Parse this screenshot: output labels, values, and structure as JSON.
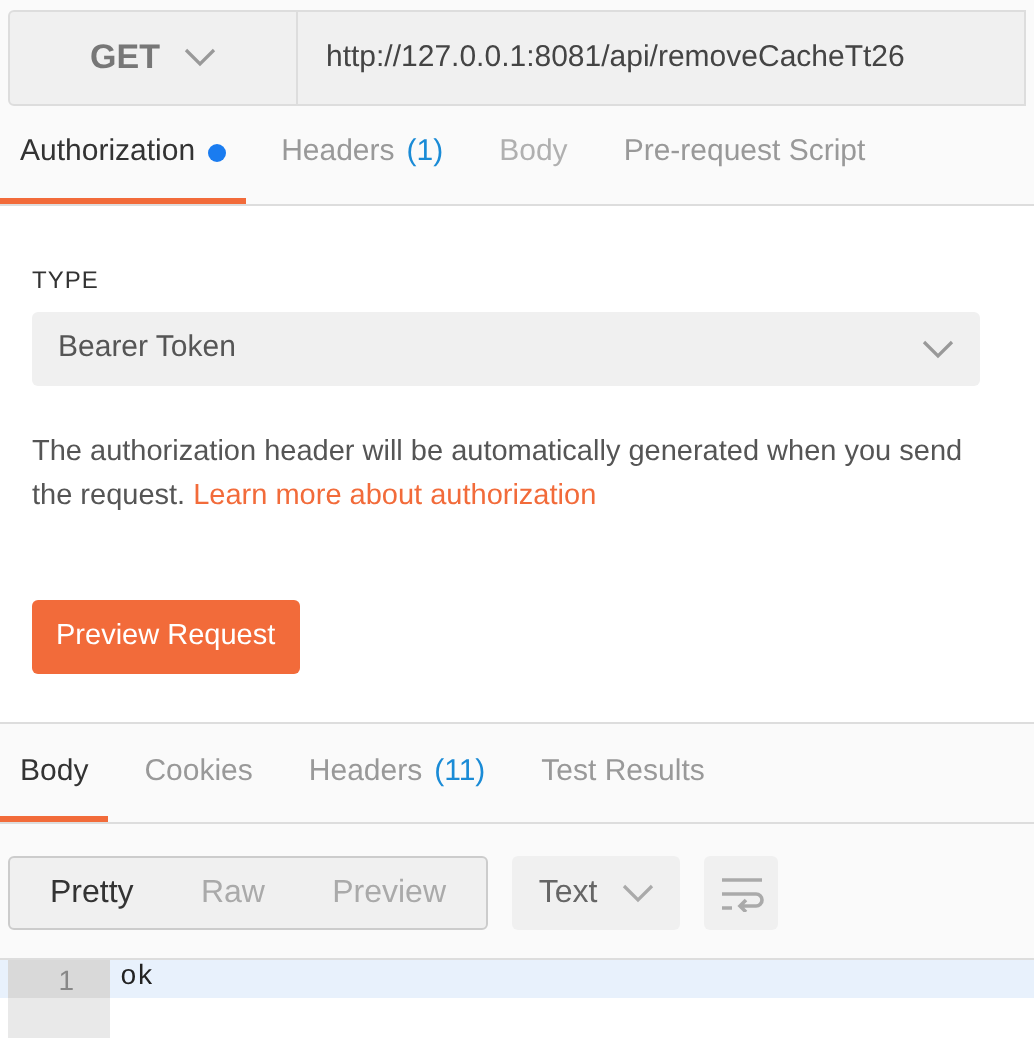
{
  "request": {
    "method": "GET",
    "url": "http://127.0.0.1:8081/api/removeCacheTt26"
  },
  "request_tabs": [
    {
      "label": "Authorization",
      "selected": true,
      "disabled": false,
      "indicator": true
    },
    {
      "label": "Headers",
      "count": "(1)",
      "selected": false,
      "disabled": false,
      "indicator": false
    },
    {
      "label": "Body",
      "selected": false,
      "disabled": true,
      "indicator": false
    },
    {
      "label": "Pre-request Script",
      "selected": false,
      "disabled": false,
      "indicator": false
    }
  ],
  "auth": {
    "type_label": "TYPE",
    "type_value": "Bearer Token",
    "description": "The authorization header will be automatically generated when you send the request.",
    "link": "Learn more about authorization",
    "button": "Preview Request"
  },
  "response_tabs": [
    {
      "label": "Body",
      "selected": true
    },
    {
      "label": "Cookies",
      "selected": false
    },
    {
      "label": "Headers",
      "count": "(11)",
      "selected": false
    },
    {
      "label": "Test Results",
      "selected": false
    }
  ],
  "view_modes": [
    {
      "label": "Pretty",
      "selected": true
    },
    {
      "label": "Raw",
      "selected": false
    },
    {
      "label": "Preview",
      "selected": false
    }
  ],
  "format": "Text",
  "editor": {
    "lines": [
      {
        "number": "1",
        "text": "ok",
        "highlighted": true
      }
    ]
  }
}
